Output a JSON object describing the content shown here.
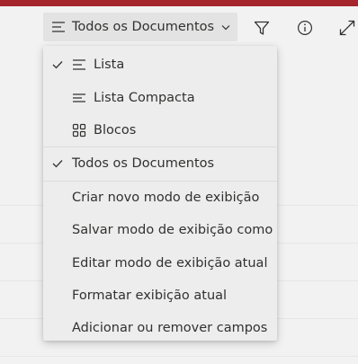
{
  "toolbar": {
    "view_label": "Todos os Documentos",
    "icons": [
      "lines-icon",
      "chevron-down-icon",
      "filter-icon",
      "info-icon",
      "expand-icon"
    ]
  },
  "menu": {
    "layouts": [
      {
        "label": "Lista",
        "checked": true,
        "icon": "list-icon"
      },
      {
        "label": "Lista Compacta",
        "checked": false,
        "icon": "compact-list-icon"
      },
      {
        "label": "Blocos",
        "checked": false,
        "icon": "tiles-icon"
      }
    ],
    "views": [
      {
        "label": "Todos os Documentos",
        "checked": true
      }
    ],
    "actions": [
      "Criar novo modo de exibição",
      "Salvar modo de exibição como",
      "Editar modo de exibição atual",
      "Formatar exibição atual",
      "Adicionar ou remover campos"
    ]
  },
  "colors": {
    "accent_strip": "#a4262c",
    "text": "#323130",
    "menu_bg": "#ededed"
  }
}
